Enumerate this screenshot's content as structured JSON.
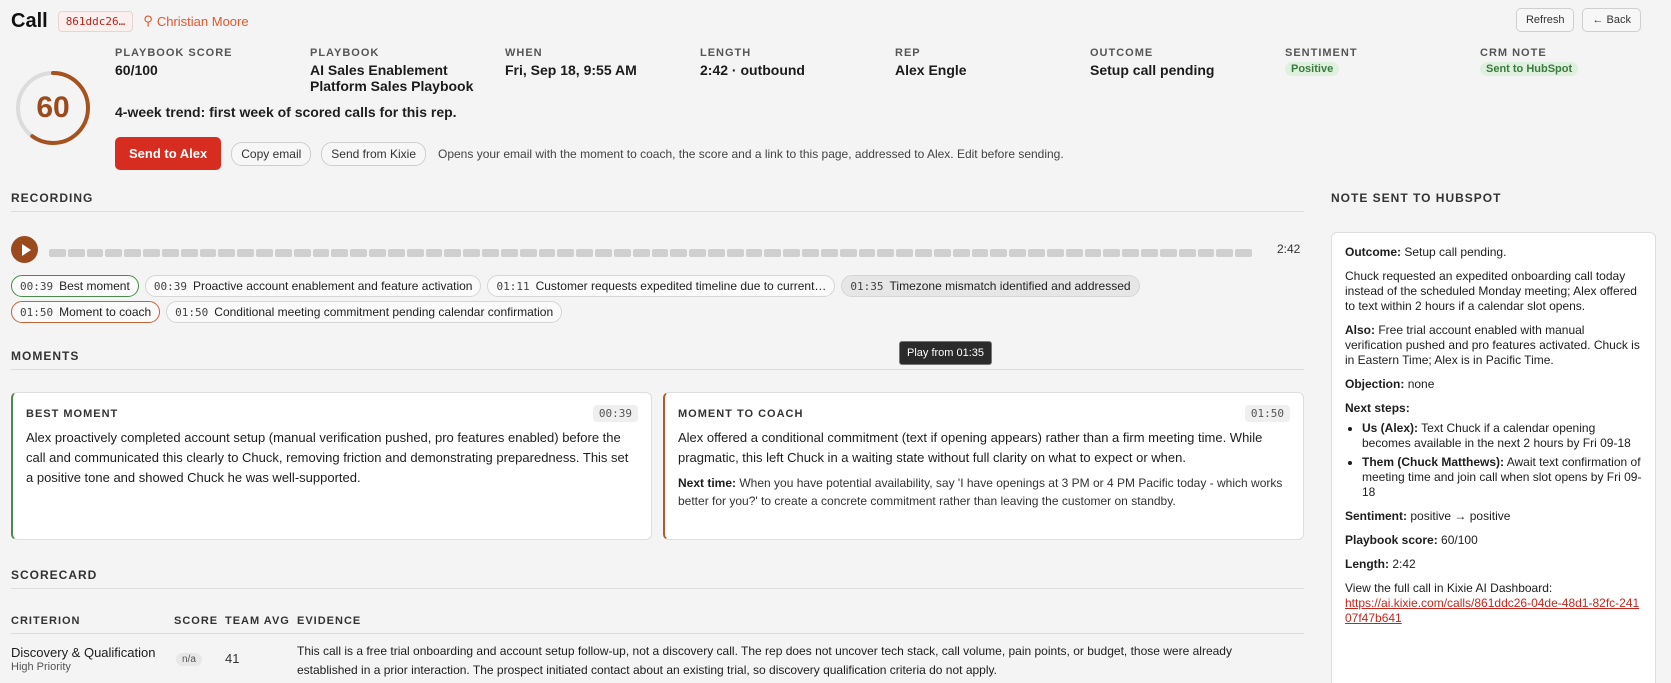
{
  "header": {
    "title": "Call",
    "call_id": "861ddc26…",
    "contact": "Christian Moore",
    "refresh_label": "Refresh",
    "back_label": "← Back"
  },
  "score": {
    "value": "60",
    "percent": 60
  },
  "meta": [
    {
      "label": "PLAYBOOK SCORE",
      "value": "60/100"
    },
    {
      "label": "PLAYBOOK",
      "value": "AI Sales Enablement Platform Sales Playbook"
    },
    {
      "label": "WHEN",
      "value": "Fri, Sep 18, 9:55 AM"
    },
    {
      "label": "LENGTH",
      "value": "2:42 · outbound"
    },
    {
      "label": "REP",
      "value": "Alex Engle"
    },
    {
      "label": "OUTCOME",
      "value": "Setup call pending"
    },
    {
      "label": "SENTIMENT",
      "value": "Positive"
    },
    {
      "label": "CRM NOTE",
      "value": "Sent to HubSpot"
    }
  ],
  "trend": "4-week trend: first week of scored calls for this rep.",
  "actions": {
    "send_label": "Send to Alex",
    "copy_label": "Copy email",
    "kixie_label": "Send from Kixie",
    "note": "Opens your email with the moment to coach, the score and a link to this page, addressed to Alex. Edit before sending."
  },
  "recording": {
    "section_label": "RECORDING",
    "duration": "2:42",
    "chips_row1": [
      {
        "time": "00:39",
        "label": "Best moment",
        "kind": "best"
      },
      {
        "time": "00:39",
        "label": "Proactive account enablement and feature activation",
        "kind": ""
      },
      {
        "time": "01:11",
        "label": "Customer requests expedited timeline due to current…",
        "kind": ""
      },
      {
        "time": "01:35",
        "label": "Timezone mismatch identified and addressed",
        "kind": "hover"
      }
    ],
    "chips_row2": [
      {
        "time": "01:50",
        "label": "Moment to coach",
        "kind": "coach"
      },
      {
        "time": "01:50",
        "label": "Conditional meeting commitment pending calendar confirmation",
        "kind": ""
      }
    ],
    "tooltip": "Play from 01:35"
  },
  "moments": {
    "section_label": "MOMENTS",
    "best": {
      "label": "BEST MOMENT",
      "time": "00:39",
      "text": "Alex proactively completed account setup (manual verification pushed, pro features enabled) before the call and communicated this clearly to Chuck, removing friction and demonstrating preparedness. This set a positive tone and showed Chuck he was well-supported."
    },
    "coach": {
      "label": "MOMENT TO COACH",
      "time": "01:50",
      "text": "Alex offered a conditional commitment (text if opening appears) rather than a firm meeting time. While pragmatic, this left Chuck in a waiting state without full clarity on what to expect or when.",
      "next_label": "Next time:",
      "next_text": "When you have potential availability, say 'I have openings at 3 PM or 4 PM Pacific today - which works better for you?' to create a concrete commitment rather than leaving the customer on standby."
    }
  },
  "scorecard": {
    "section_label": "SCORECARD",
    "columns": [
      "CRITERION",
      "SCORE",
      "TEAM AVG",
      "EVIDENCE"
    ],
    "rows": [
      {
        "criterion": "Discovery & Qualification",
        "priority": "High Priority",
        "score": "n/a",
        "team_avg": "41",
        "evidence": "This call is a free trial onboarding and account setup follow-up, not a discovery call. The rep does not uncover tech stack, call volume, pain points, or budget, those were already established in a prior interaction. The prospect initiated contact about an existing trial, so discovery qualification criteria do not apply."
      }
    ]
  },
  "hubspot": {
    "section_label": "NOTE SENT TO HUBSPOT",
    "outcome_label": "Outcome:",
    "outcome": "Setup call pending.",
    "summary": "Chuck requested an expedited onboarding call today instead of the scheduled Monday meeting; Alex offered to text within 2 hours if a calendar slot opens.",
    "also_label": "Also:",
    "also": "Free trial account enabled with manual verification pushed and pro features activated. Chuck is in Eastern Time; Alex is in Pacific Time.",
    "objection_label": "Objection:",
    "objection": "none",
    "next_steps_label": "Next steps:",
    "us_label": "Us (Alex):",
    "us": "Text Chuck if a calendar opening becomes available in the next 2 hours by Fri 09-18",
    "them_label": "Them (Chuck Matthews):",
    "them": "Await text confirmation of meeting time and join call when slot opens by Fri 09-18",
    "sentiment_label": "Sentiment:",
    "sentiment": "positive → positive",
    "score_label": "Playbook score:",
    "score": "60/100",
    "length_label": "Length:",
    "length": "2:42",
    "view_label": "View the full call in Kixie AI Dashboard:",
    "link": "https://ai.kixie.com/calls/861ddc26-04de-48d1-82fc-24107f47b641"
  }
}
